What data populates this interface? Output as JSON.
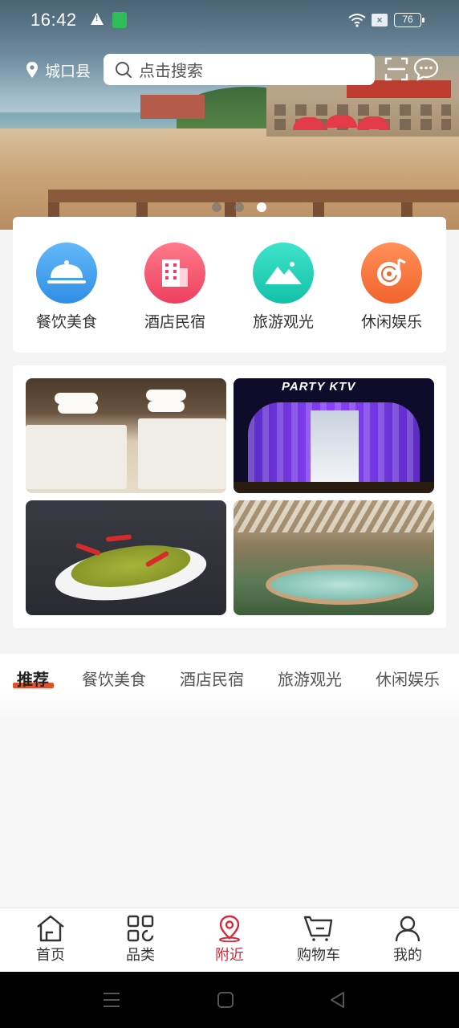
{
  "status_bar": {
    "time": "16:42",
    "battery": "76"
  },
  "location": {
    "city": "城口县"
  },
  "search": {
    "placeholder": "点击搜索"
  },
  "carousel": {
    "count": 3,
    "active_index": 2
  },
  "categories": [
    {
      "label": "餐饮美食",
      "icon": "cloche-icon",
      "color": "#3a98ea"
    },
    {
      "label": "酒店民宿",
      "icon": "building-icon",
      "color": "#f0506a"
    },
    {
      "label": "旅游观光",
      "icon": "mountain-icon",
      "color": "#1fcfb8"
    },
    {
      "label": "休闲娱乐",
      "icon": "music-disc-icon",
      "color": "#f4733a"
    }
  ],
  "promo_tiles": [
    {
      "name": "hotel-room-photo"
    },
    {
      "name": "ktv-building-photo",
      "sign": "PARTY KTV"
    },
    {
      "name": "fish-dish-photo"
    },
    {
      "name": "hot-spring-pool-photo"
    }
  ],
  "tabs": [
    {
      "label": "推荐",
      "active": true
    },
    {
      "label": "餐饮美食",
      "active": false
    },
    {
      "label": "酒店民宿",
      "active": false
    },
    {
      "label": "旅游观光",
      "active": false
    },
    {
      "label": "休闲娱乐",
      "active": false
    }
  ],
  "bottom_nav": [
    {
      "label": "首页",
      "icon": "home-icon",
      "active": false
    },
    {
      "label": "品类",
      "icon": "category-grid-icon",
      "active": false
    },
    {
      "label": "附近",
      "icon": "location-pin-icon",
      "active": true
    },
    {
      "label": "购物车",
      "icon": "cart-icon",
      "active": false
    },
    {
      "label": "我的",
      "icon": "user-icon",
      "active": false
    }
  ],
  "colors": {
    "accent": "#d42a3a",
    "tab_underline": "#e2512b"
  }
}
